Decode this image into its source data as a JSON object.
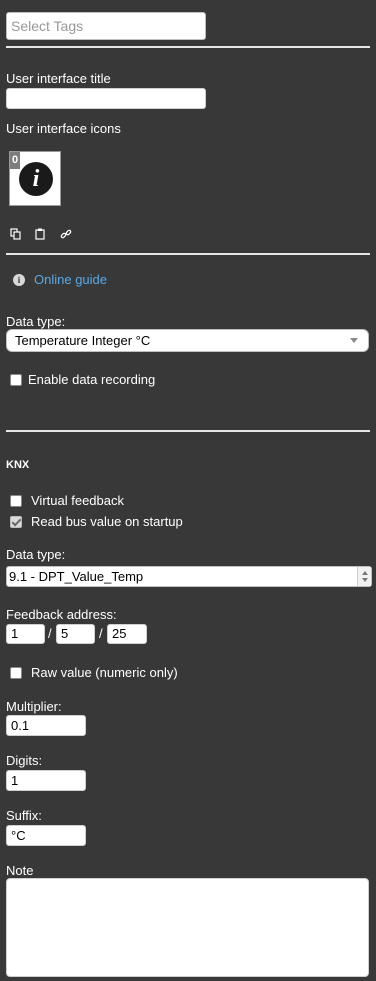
{
  "tags": {
    "placeholder": "Select Tags"
  },
  "ui_title": {
    "label": "User interface title",
    "value": ""
  },
  "ui_icons": {
    "label": "User interface icons",
    "badge": "0",
    "icon": "info-icon"
  },
  "icon_tools": [
    "copy-icon",
    "paste-icon",
    "link-icon"
  ],
  "guide": {
    "icon": "info-circle-icon",
    "label": "Online guide",
    "color": "#5aa9e6"
  },
  "data_type": {
    "label": "Data type:",
    "value": "Temperature Integer °C"
  },
  "recording": {
    "label": "Enable data recording",
    "checked": false
  },
  "knx": {
    "heading": "KNX",
    "virtual_feedback": {
      "label": "Virtual feedback",
      "checked": false
    },
    "read_bus": {
      "label": "Read bus value on startup",
      "checked": true
    },
    "data_type": {
      "label": "Data type:",
      "value": "9.1 - DPT_Value_Temp"
    },
    "feedback_address": {
      "label": "Feedback address:",
      "parts": [
        "1",
        "5",
        "25"
      ],
      "sep": "/"
    },
    "raw_value": {
      "label": "Raw value (numeric only)",
      "checked": false
    },
    "multiplier": {
      "label": "Multiplier:",
      "value": "0.1"
    },
    "digits": {
      "label": "Digits:",
      "value": "1"
    },
    "suffix": {
      "label": "Suffix:",
      "value": "°C"
    },
    "note": {
      "label": "Note",
      "value": ""
    }
  }
}
